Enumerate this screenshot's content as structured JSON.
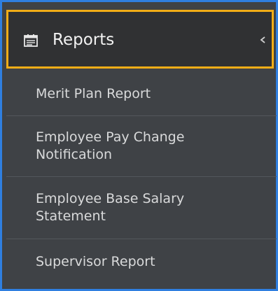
{
  "header": {
    "title": "Reports",
    "icon": "report-calendar-icon",
    "chevron": "chevron-left-icon",
    "accent_color": "#f2ad17"
  },
  "menu": {
    "items": [
      {
        "label": "Merit Plan Report"
      },
      {
        "label": "Employee Pay Change\nNotification"
      },
      {
        "label": "Employee Base Salary\nStatement"
      },
      {
        "label": "Supervisor Report"
      }
    ]
  },
  "colors": {
    "frame_border": "#2f7fe0",
    "menu_background": "#3f4246",
    "header_background": "#303133",
    "text": "#d9dadb"
  }
}
